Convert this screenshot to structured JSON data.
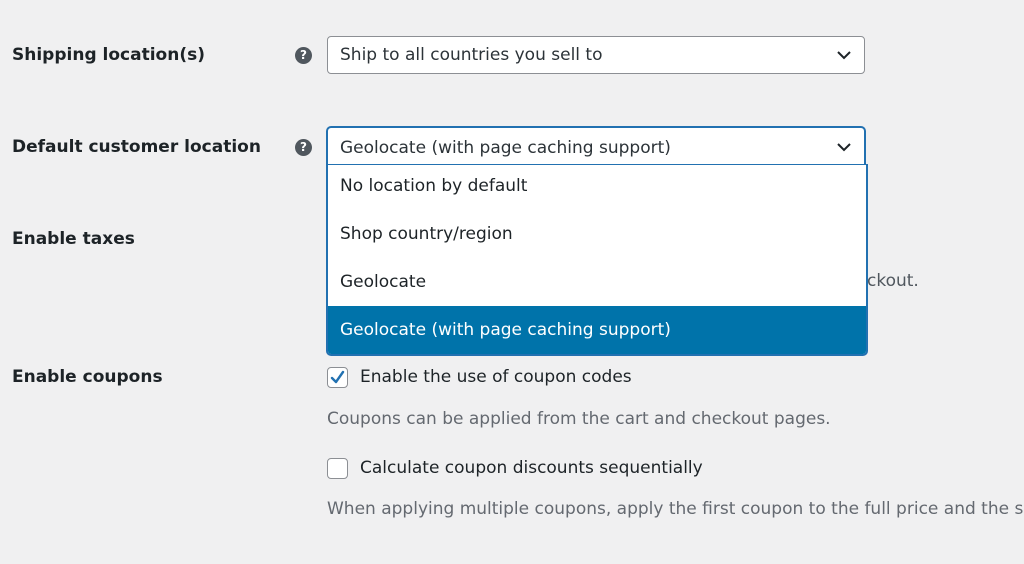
{
  "settings": {
    "shipping_location": {
      "label": "Shipping location(s)",
      "help": "?",
      "value": "Ship to all countries you sell to"
    },
    "default_customer_location": {
      "label": "Default customer location",
      "help": "?",
      "value": "Geolocate (with page caching support)",
      "options": [
        "No location by default",
        "Shop country/region",
        "Geolocate",
        "Geolocate (with page caching support)"
      ]
    },
    "enable_taxes": {
      "label": "Enable taxes",
      "description_tail": "ckout."
    },
    "enable_coupons": {
      "label": "Enable coupons",
      "checkbox_label": "Enable the use of coupon codes",
      "checked": true,
      "description": "Coupons can be applied from the cart and checkout pages."
    },
    "sequential": {
      "checkbox_label": "Calculate coupon discounts sequentially",
      "checked": false,
      "description": "When applying multiple coupons, apply the first coupon to the full price and the sec"
    }
  },
  "colors": {
    "accent": "#2271b1",
    "selected_option_bg": "#0073aa"
  },
  "icons": {
    "help": "help-icon",
    "chevron": "chevron-down-icon",
    "check": "checkmark-icon"
  }
}
